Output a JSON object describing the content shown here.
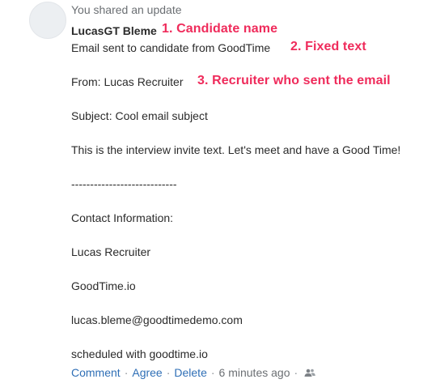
{
  "post": {
    "header": "You shared an update",
    "candidate_name": "LucasGT Bleme",
    "line_fixed": "Email sent to candidate from GoodTime",
    "from": "From: Lucas Recruiter",
    "subject": "Subject: Cool email subject",
    "body": "This is the interview invite text. Let's meet and have a Good Time!",
    "divider": "----------------------------",
    "contact_heading": "Contact Information:",
    "contact_name": "Lucas Recruiter",
    "contact_company": "GoodTime.io",
    "contact_email": "lucas.bleme@goodtimedemo.com",
    "footer": "scheduled with goodtime.io"
  },
  "annotations": {
    "a1": "1. Candidate name",
    "a2": "2. Fixed text",
    "a3": "3. Recruiter who sent the email"
  },
  "actions": {
    "comment": "Comment",
    "agree": "Agree",
    "delete": "Delete",
    "separator": "·",
    "time": "6 minutes ago"
  },
  "icons": {
    "avatar": "avatar-placeholder",
    "visibility": "people-icon"
  },
  "colors": {
    "annotation": "#ef2b5b",
    "link": "#2f6fb6"
  }
}
